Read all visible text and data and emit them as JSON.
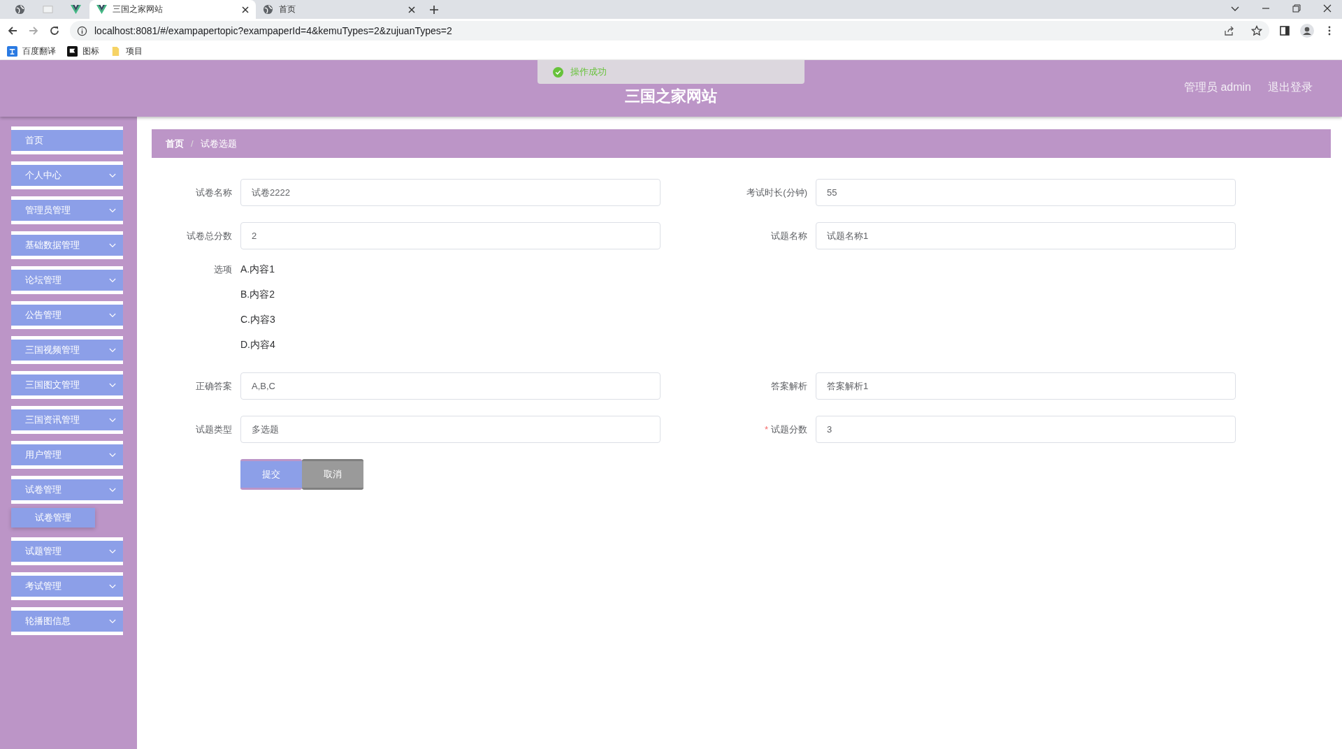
{
  "browser": {
    "tabs": [
      {
        "kind": "globe",
        "selected": false
      },
      {
        "kind": "blank",
        "selected": false
      },
      {
        "kind": "vue",
        "selected": false
      },
      {
        "kind": "vue",
        "label": "三国之家网站",
        "selected": true
      },
      {
        "kind": "globe",
        "label": "首页",
        "selected": false
      }
    ],
    "address": "localhost:8081/#/exampapertopic?exampaperId=4&kemuTypes=2&zujuanTypes=2",
    "bookmarks": [
      {
        "kind": "translate",
        "label": "百度翻译"
      },
      {
        "kind": "flag",
        "label": "图标"
      },
      {
        "kind": "folder",
        "label": "项目"
      }
    ]
  },
  "toast": {
    "message": "操作成功"
  },
  "header": {
    "title": "三国之家网站",
    "user": "管理员 admin",
    "logout": "退出登录"
  },
  "sidebar": {
    "items": [
      {
        "label": "首页",
        "kind": "link"
      },
      {
        "label": "个人中心",
        "kind": "submenu"
      },
      {
        "label": "管理员管理",
        "kind": "submenu"
      },
      {
        "label": "基础数据管理",
        "kind": "submenu"
      },
      {
        "label": "论坛管理",
        "kind": "submenu"
      },
      {
        "label": "公告管理",
        "kind": "submenu"
      },
      {
        "label": "三国视频管理",
        "kind": "submenu"
      },
      {
        "label": "三国图文管理",
        "kind": "submenu"
      },
      {
        "label": "三国资讯管理",
        "kind": "submenu"
      },
      {
        "label": "用户管理",
        "kind": "submenu"
      },
      {
        "label": "试卷管理",
        "kind": "submenu",
        "children": [
          {
            "label": "试卷管理"
          }
        ]
      },
      {
        "label": "试题管理",
        "kind": "submenu"
      },
      {
        "label": "考试管理",
        "kind": "submenu"
      },
      {
        "label": "轮播图信息",
        "kind": "submenu"
      }
    ]
  },
  "breadcrumb": {
    "separator": "/",
    "items": [
      "首页",
      "试卷选题"
    ]
  },
  "form": {
    "rows": [
      {
        "kind": "fields",
        "fields": [
          {
            "label": "试卷名称",
            "value": "试卷2222"
          },
          {
            "label": "考试时长(分钟)",
            "value": "55"
          }
        ]
      },
      {
        "kind": "fields",
        "fields": [
          {
            "label": "试卷总分数",
            "value": "2"
          },
          {
            "label": "试题名称",
            "value": "试题名称1"
          }
        ]
      },
      {
        "kind": "options",
        "label": "选项",
        "options": [
          "A.内容1",
          "B.内容2",
          "C.内容3",
          "D.内容4"
        ]
      },
      {
        "kind": "fields",
        "fields": [
          {
            "label": "正确答案",
            "value": "A,B,C"
          },
          {
            "label": "答案解析",
            "value": "答案解析1"
          }
        ]
      },
      {
        "kind": "fields",
        "fields": [
          {
            "label": "试题类型",
            "value": "多选题"
          },
          {
            "label": "试题分数",
            "value": "3",
            "required_mark": "*"
          }
        ]
      }
    ],
    "buttons": [
      {
        "label": "提交",
        "kind": "primary"
      },
      {
        "label": "取消",
        "kind": "cancel"
      }
    ]
  }
}
